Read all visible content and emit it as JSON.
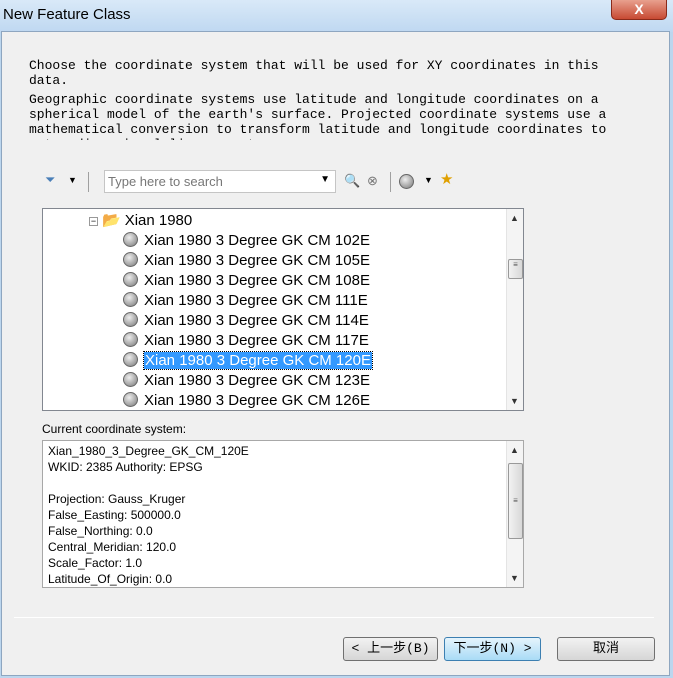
{
  "window": {
    "title": "New Feature Class",
    "close": "X"
  },
  "description": [
    "Choose the coordinate system that will be used for XY coordinates in this data.",
    "Geographic coordinate systems use latitude and longitude coordinates on a spherical model of the earth's surface. Projected coordinate systems use a mathematical conversion to transform latitude and longitude coordinates to a two-dimensional linear system."
  ],
  "toolbar": {
    "search_placeholder": "Type here to search"
  },
  "tree": {
    "folder": "Xian 1980",
    "items": [
      "Xian 1980 3 Degree GK CM 102E",
      "Xian 1980 3 Degree GK CM 105E",
      "Xian 1980 3 Degree GK CM 108E",
      "Xian 1980 3 Degree GK CM 111E",
      "Xian 1980 3 Degree GK CM 114E",
      "Xian 1980 3 Degree GK CM 117E",
      "Xian 1980 3 Degree GK CM 120E",
      "Xian 1980 3 Degree GK CM 123E",
      "Xian 1980 3 Degree GK CM 126E"
    ],
    "selected": "Xian 1980 3 Degree GK CM 120E"
  },
  "current": {
    "label": "Current coordinate system:",
    "lines": [
      "Xian_1980_3_Degree_GK_CM_120E",
      "WKID: 2385 Authority: EPSG",
      "",
      "Projection: Gauss_Kruger",
      "False_Easting: 500000.0",
      "False_Northing: 0.0",
      "Central_Meridian: 120.0",
      "Scale_Factor: 1.0",
      "Latitude_Of_Origin: 0.0"
    ]
  },
  "buttons": {
    "back": "< 上一步(B)",
    "next": "下一步(N) >",
    "cancel": "取消"
  },
  "colors": {
    "selection": "#3399ff"
  }
}
